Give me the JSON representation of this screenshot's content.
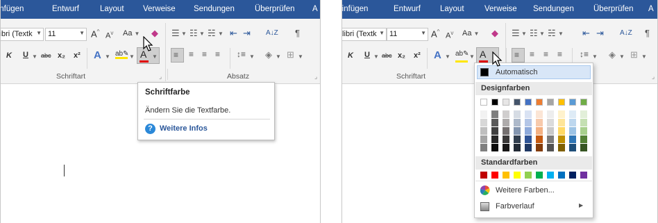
{
  "tabs": [
    "Einfügen",
    "Entwurf",
    "Layout",
    "Verweise",
    "Sendungen",
    "Überprüfen",
    "A"
  ],
  "tabs_right": [
    "Einfügen",
    "Entwurf",
    "Layout",
    "Verweise",
    "Sendungen",
    "Überprüfen",
    "A"
  ],
  "ribbon": {
    "font_name": "Calibri (Textk",
    "font_size": "11",
    "grow_font": "A",
    "shrink_font": "A",
    "change_case": "Aa",
    "bold": "K",
    "underline": "U",
    "strikethrough": "abc",
    "subscript": "x₂",
    "superscript": "x²",
    "text_effects": "A",
    "highlight": "ab",
    "font_color": "A",
    "sort": "A↓Z",
    "pilcrow": "¶",
    "group_font": "Schriftart",
    "group_paragraph": "Absatz"
  },
  "tooltip": {
    "title": "Schriftfarbe",
    "description": "Ändern Sie die Textfarbe.",
    "link": "Weitere Infos",
    "help_symbol": "?"
  },
  "color_menu": {
    "automatic": "Automatisch",
    "theme_header": "Designfarben",
    "standard_header": "Standardfarben",
    "more_colors": "Weitere Farben...",
    "gradient": "Farbverlauf",
    "theme_base": [
      "#ffffff",
      "#000000",
      "#e7e6e6",
      "#44546a",
      "#4472c4",
      "#ed7d31",
      "#a5a5a5",
      "#ffc000",
      "#5b9bd5",
      "#70ad47"
    ],
    "theme_shades": [
      [
        "#f2f2f2",
        "#7f7f7f",
        "#d0cece",
        "#d6dce4",
        "#d9e2f3",
        "#fbe5d5",
        "#ededed",
        "#fff2cc",
        "#deebf6",
        "#e2efd9"
      ],
      [
        "#d8d8d8",
        "#595959",
        "#aeabab",
        "#adb9ca",
        "#b4c6e7",
        "#f7caac",
        "#dbdbdb",
        "#fee599",
        "#bdd7ee",
        "#c5e0b3"
      ],
      [
        "#bfbfbf",
        "#3f3f3f",
        "#757070",
        "#8496b0",
        "#8eaadb",
        "#f4b183",
        "#c9c9c9",
        "#ffd965",
        "#9cc3e5",
        "#a8d08d"
      ],
      [
        "#a5a5a5",
        "#262626",
        "#3a3838",
        "#323f4f",
        "#2f5496",
        "#c55a11",
        "#7b7b7b",
        "#bf9000",
        "#2e75b5",
        "#538135"
      ],
      [
        "#7f7f7f",
        "#0c0c0c",
        "#171616",
        "#222a35",
        "#1f3864",
        "#833c0b",
        "#525252",
        "#7f6000",
        "#1e4e79",
        "#375623"
      ]
    ],
    "standard": [
      "#c00000",
      "#ff0000",
      "#ffc000",
      "#ffff00",
      "#92d050",
      "#00b050",
      "#00b0f0",
      "#0070c0",
      "#002060",
      "#7030a0"
    ]
  },
  "colors": {
    "tab_blue": "#2b579a",
    "font_color_red": "#e00000",
    "highlight_yellow": "#ffe600",
    "help_blue": "#2b88d8"
  }
}
